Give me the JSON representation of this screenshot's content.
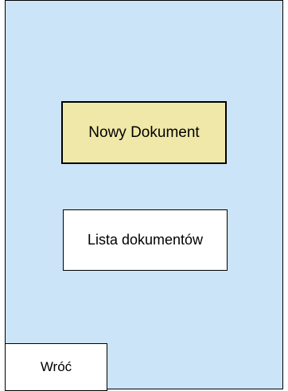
{
  "colors": {
    "background": "#cce4f7",
    "primary_button": "#f0e8a8",
    "secondary_button": "#ffffff"
  },
  "menu": {
    "new_document_label": "Nowy Dokument",
    "document_list_label": "Lista dokumentów",
    "back_label": "Wróć"
  }
}
